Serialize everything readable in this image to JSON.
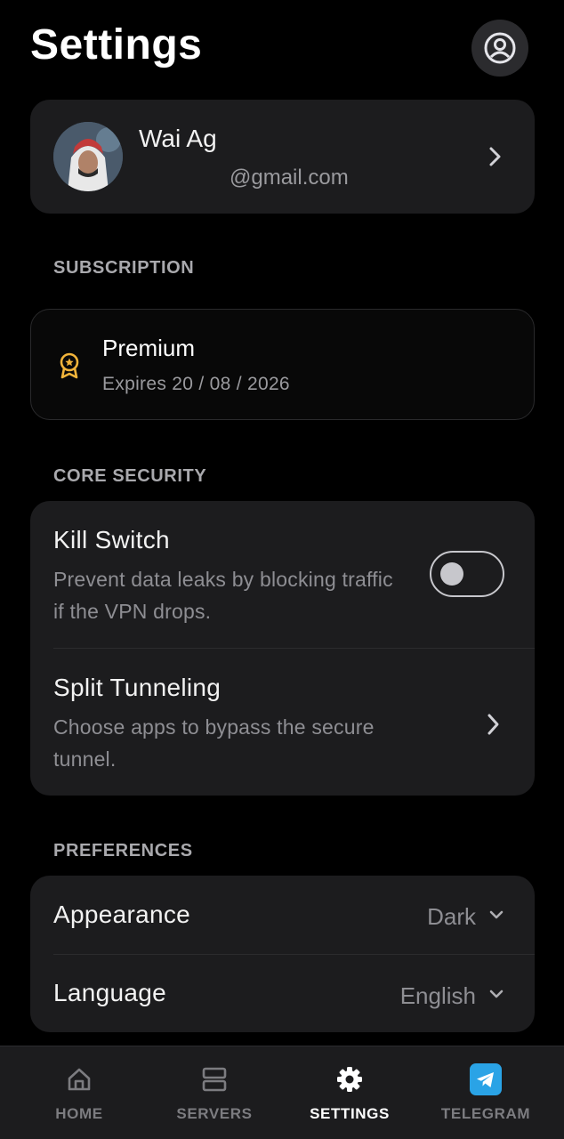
{
  "header": {
    "title": "Settings",
    "account_icon": "user-circle-icon"
  },
  "profile": {
    "name": "Wai Ag",
    "email": "@gmail.com",
    "avatar_icon": "avatar-photo",
    "chevron_icon": "chevron-right-icon"
  },
  "subscription": {
    "section_label": "SUBSCRIPTION",
    "plan": "Premium",
    "expiry": "Expires 20 / 08 / 2026",
    "icon": "award-badge-icon",
    "icon_color": "#f2b43a"
  },
  "core_security": {
    "section_label": "CORE SECURITY",
    "kill_switch": {
      "title": "Kill Switch",
      "description": "Prevent data leaks by blocking traffic if the VPN drops.",
      "enabled": false
    },
    "split_tunneling": {
      "title": "Split Tunneling",
      "description": "Choose apps to bypass the secure tunnel.",
      "chevron_icon": "chevron-right-icon"
    }
  },
  "preferences": {
    "section_label": "PREFERENCES",
    "appearance": {
      "label": "Appearance",
      "value": "Dark",
      "caret_icon": "chevron-down-icon"
    },
    "language": {
      "label": "Language",
      "value": "English",
      "caret_icon": "chevron-down-icon"
    }
  },
  "bottom_nav": {
    "active": "SETTINGS",
    "items": [
      {
        "label": "HOME",
        "icon": "home-icon"
      },
      {
        "label": "SERVERS",
        "icon": "server-icon"
      },
      {
        "label": "SETTINGS",
        "icon": "gear-icon"
      },
      {
        "label": "TELEGRAM",
        "icon": "telegram-icon",
        "color": "#2aa3e6"
      }
    ]
  },
  "colors": {
    "background": "#000000",
    "card": "#1c1c1e",
    "text_primary": "#ffffff",
    "text_secondary": "#8e8e93",
    "section_label": "#a9a9ad"
  }
}
